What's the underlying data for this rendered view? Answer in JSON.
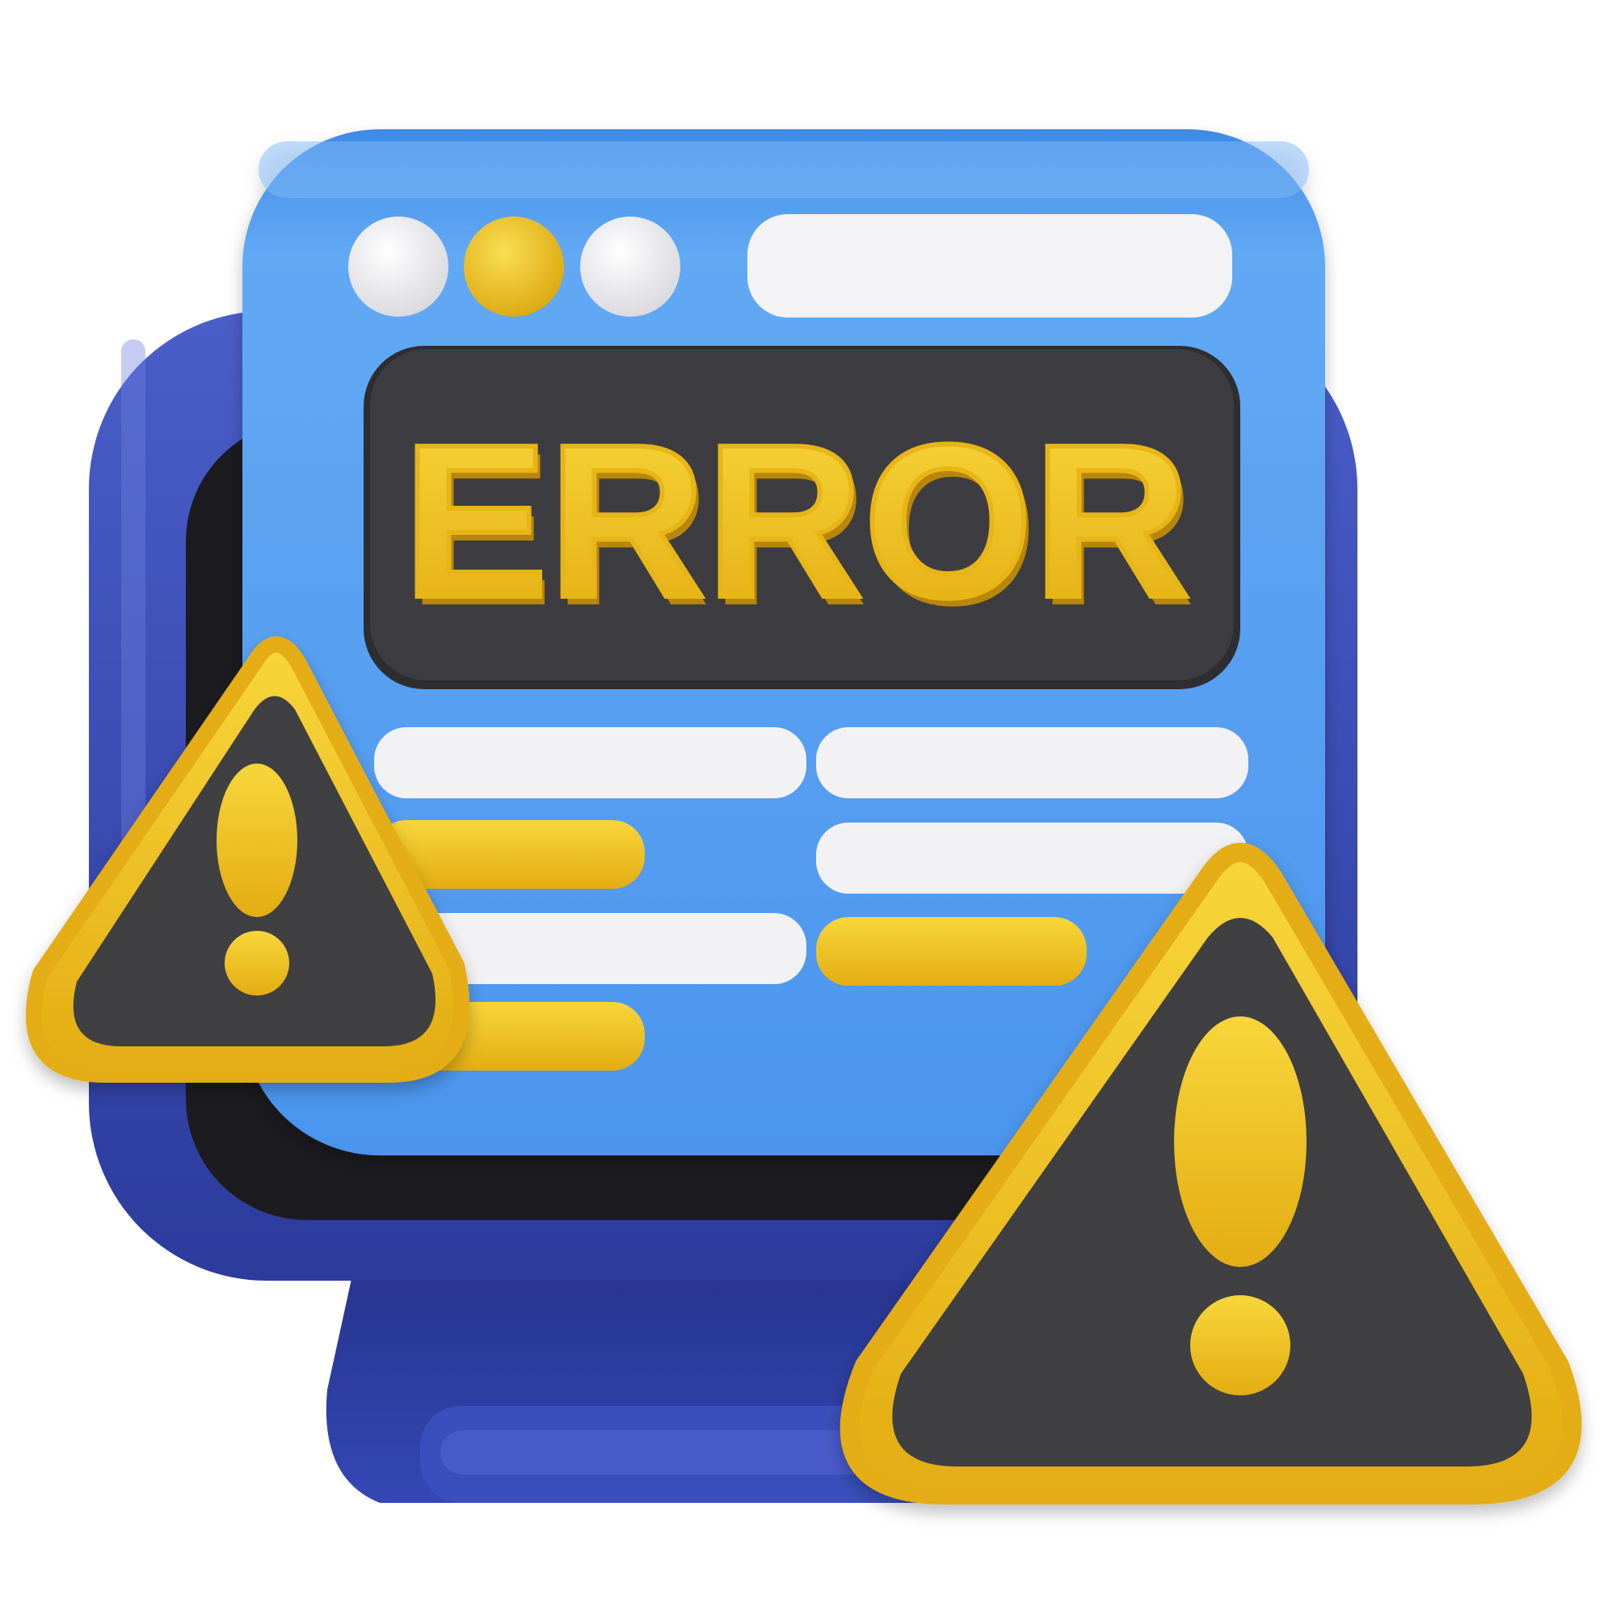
{
  "screen": {
    "title": "ERROR",
    "window_dots": [
      "close-dot",
      "minimize-dot",
      "maximize-dot"
    ],
    "content_lines": [
      {
        "column": "left",
        "style": "white"
      },
      {
        "column": "left",
        "style": "yellow"
      },
      {
        "column": "left",
        "style": "white"
      },
      {
        "column": "left",
        "style": "yellow"
      },
      {
        "column": "right",
        "style": "white"
      },
      {
        "column": "right",
        "style": "white"
      },
      {
        "column": "right",
        "style": "yellow"
      }
    ]
  },
  "warnings": [
    {
      "icon": "warning-triangle-icon",
      "glyph": "exclamation-mark"
    },
    {
      "icon": "warning-triangle-icon",
      "glyph": "exclamation-mark"
    }
  ],
  "colors": {
    "monitor_back": "#3a4fb8",
    "monitor_back_dark": "#2a3a96",
    "screen_bezel": "#1f1f22",
    "window_blue": "#4f98ee",
    "window_blue_light": "#6fb2f7",
    "banner_dark": "#3b3b3f",
    "accent_yellow": "#f2c31c",
    "accent_yellow_dark": "#d9a30f",
    "line_white": "#f2f2f4",
    "triangle_fill": "#3f3f43"
  }
}
